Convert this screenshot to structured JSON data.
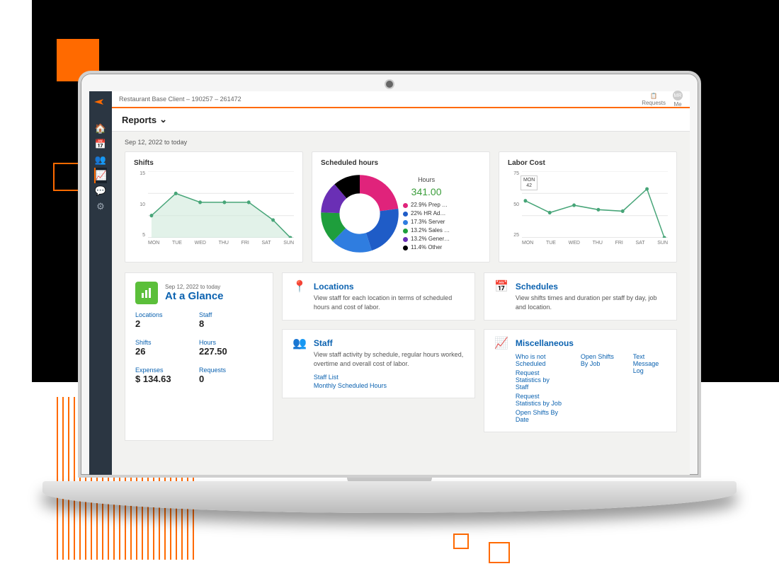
{
  "header": {
    "breadcrumb": "Restaurant Base Client – 190257 – 261472",
    "requests_label": "Requests",
    "me_label": "Me",
    "avatar_initials": "MR",
    "page_title": "Reports"
  },
  "date_range": "Sep 12, 2022 to today",
  "sidebar": [
    {
      "name": "home-icon",
      "glyph": "🏠"
    },
    {
      "name": "calendar-icon",
      "glyph": "📅"
    },
    {
      "name": "people-icon",
      "glyph": "👥"
    },
    {
      "name": "chart-icon",
      "glyph": "📈",
      "active": true
    },
    {
      "name": "chat-icon",
      "glyph": "💬"
    },
    {
      "name": "gear-icon",
      "glyph": "⚙"
    }
  ],
  "charts": {
    "shifts": {
      "title": "Shifts",
      "y_ticks": [
        "15",
        "10",
        "5"
      ],
      "x_labels": [
        "MON",
        "TUE",
        "WED",
        "THU",
        "FRI",
        "SAT",
        "SUN"
      ]
    },
    "scheduled": {
      "title": "Scheduled hours",
      "hours_label": "Hours",
      "total": "341.00",
      "legend": [
        {
          "label": "22.9% Prep …",
          "color": "#e0237b"
        },
        {
          "label": "22% HR Ad…",
          "color": "#1f5cc7"
        },
        {
          "label": "17.3% Server",
          "color": "#2f7de0"
        },
        {
          "label": "13.2% Sales …",
          "color": "#1e9e3c"
        },
        {
          "label": "13.2% Gener…",
          "color": "#6a2fb5"
        },
        {
          "label": "11.4% Other",
          "color": "#000000"
        }
      ]
    },
    "labor": {
      "title": "Labor Cost",
      "y_ticks": [
        "75",
        "50",
        "25"
      ],
      "x_labels": [
        "MON",
        "TUE",
        "WED",
        "THU",
        "FRI",
        "SAT",
        "SUN"
      ],
      "tooltip_day": "MON",
      "tooltip_val": "42"
    }
  },
  "glance": {
    "sub": "Sep 12, 2022 to today",
    "title": "At a Glance",
    "stats": [
      {
        "label": "Locations",
        "value": "2"
      },
      {
        "label": "Staff",
        "value": "8"
      },
      {
        "label": "Shifts",
        "value": "26"
      },
      {
        "label": "Hours",
        "value": "227.50"
      },
      {
        "label": "Expenses",
        "value": "$ 134.63"
      },
      {
        "label": "Requests",
        "value": "0"
      }
    ]
  },
  "cards": {
    "locations": {
      "title": "Locations",
      "desc": "View staff for each location in terms of scheduled hours and cost of labor."
    },
    "schedules": {
      "title": "Schedules",
      "desc": "View shifts times and duration per staff by day, job and location."
    },
    "staff": {
      "title": "Staff",
      "desc": "View staff activity by schedule, regular hours worked, overtime and overall cost of labor.",
      "links": [
        "Staff List",
        "Monthly Scheduled Hours"
      ]
    },
    "misc": {
      "title": "Miscellaneous",
      "col1": [
        "Who is not Scheduled",
        "Request Statistics by Staff",
        "Request Statistics by Job",
        "Open Shifts By Date"
      ],
      "col2": [
        "Open Shifts By Job"
      ],
      "col3": [
        "Text Message Log"
      ]
    }
  },
  "chart_data": [
    {
      "type": "line",
      "title": "Shifts",
      "x": [
        "MON",
        "TUE",
        "WED",
        "THU",
        "FRI",
        "SAT",
        "SUN"
      ],
      "values": [
        5,
        10,
        8,
        8,
        8,
        4,
        0
      ],
      "ylim": [
        0,
        15
      ],
      "ylabel": "",
      "xlabel": ""
    },
    {
      "type": "pie",
      "title": "Scheduled hours",
      "total_label": "Hours",
      "total": 341.0,
      "series": [
        {
          "name": "Prep",
          "value": 22.9,
          "color": "#e0237b"
        },
        {
          "name": "HR Ad",
          "value": 22.0,
          "color": "#1f5cc7"
        },
        {
          "name": "Server",
          "value": 17.3,
          "color": "#2f7de0"
        },
        {
          "name": "Sales",
          "value": 13.2,
          "color": "#1e9e3c"
        },
        {
          "name": "Gener",
          "value": 13.2,
          "color": "#6a2fb5"
        },
        {
          "name": "Other",
          "value": 11.4,
          "color": "#000000"
        }
      ]
    },
    {
      "type": "line",
      "title": "Labor Cost",
      "x": [
        "MON",
        "TUE",
        "WED",
        "THU",
        "FRI",
        "SAT",
        "SUN"
      ],
      "values": [
        42,
        28,
        37,
        32,
        30,
        55,
        0
      ],
      "ylim": [
        0,
        75
      ],
      "ylabel": "",
      "xlabel": "",
      "annotations": [
        {
          "x": "MON",
          "y": 42,
          "text": "MON 42"
        }
      ]
    }
  ]
}
